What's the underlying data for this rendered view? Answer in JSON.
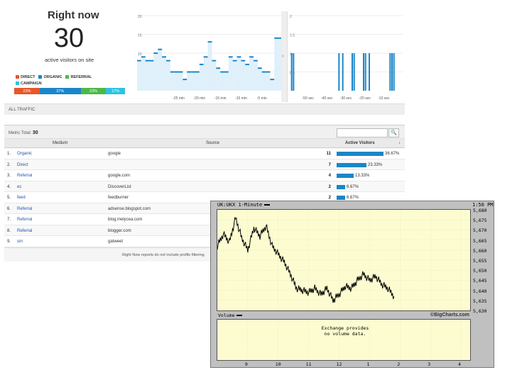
{
  "right_now": {
    "title": "Right now",
    "count": "30",
    "subtitle": "active visitors on site",
    "legend": [
      {
        "label": "DIRECT",
        "color": "#e8562a"
      },
      {
        "label": "ORGANIC",
        "color": "#1a86c8"
      },
      {
        "label": "REFERRAL",
        "color": "#4db848"
      },
      {
        "label": "CAMPAIGN",
        "color": "#2cc2e6"
      }
    ],
    "share": [
      {
        "label": "23%",
        "value": 23,
        "color": "#e8562a"
      },
      {
        "label": "37%",
        "value": 37,
        "color": "#1a86c8"
      },
      {
        "label": "23%",
        "value": 23,
        "color": "#4db848"
      },
      {
        "label": "17%",
        "value": 17,
        "color": "#2cc2e6"
      }
    ]
  },
  "chart_data": [
    {
      "type": "bar",
      "name": "per-minute",
      "ylim": [
        0,
        20
      ],
      "yticks": [
        "20",
        "15",
        "10",
        "5"
      ],
      "xticks": [
        "-25 min",
        "-20 min",
        "-15 min",
        "-10 min",
        "-5 min"
      ],
      "xtick_pos": [
        25,
        20,
        15,
        10,
        5
      ],
      "values": [
        8,
        9,
        8,
        8,
        10,
        11,
        9,
        8,
        5,
        5,
        5,
        3,
        5,
        5,
        5,
        7,
        9,
        13,
        8,
        6,
        5,
        5,
        9,
        8,
        9,
        8,
        7,
        9,
        8,
        6,
        5,
        5,
        3,
        14,
        14
      ],
      "color": "#1a86c8"
    },
    {
      "type": "bar",
      "name": "per-second",
      "ylim": [
        0,
        2
      ],
      "yticks": [
        "2",
        "1.5",
        "1",
        "0.5"
      ],
      "xticks": [
        "-50 sec",
        "-40 sec",
        "-30 sec",
        "-20 sec",
        "-10 sec"
      ],
      "xtick_pos": [
        50,
        40,
        30,
        20,
        10
      ],
      "bars_at": [
        59,
        58,
        34,
        32,
        27,
        26,
        21,
        20,
        18,
        7,
        6,
        5
      ],
      "value": 1,
      "color": "#1a86c8"
    }
  ],
  "all_traffic": "ALL TRAFFIC",
  "table": {
    "metric_label": "Metric Total:",
    "metric_value": "30",
    "search_button": "🔍",
    "headers": {
      "medium": "Medium",
      "source": "Source",
      "active": "Active Visitors",
      "sort": "↓"
    },
    "rows": [
      {
        "num": "1.",
        "medium": "Organic",
        "source": "google",
        "value": "11",
        "pct": "36.67%",
        "fraction": 0.3667
      },
      {
        "num": "2.",
        "medium": "Direct",
        "source": "",
        "value": "7",
        "pct": "23.33%",
        "fraction": 0.2333
      },
      {
        "num": "3.",
        "medium": "Referral",
        "source": "google.com",
        "value": "4",
        "pct": "13.33%",
        "fraction": 0.1333
      },
      {
        "num": "4.",
        "medium": "ec",
        "source": "DiscoverList",
        "value": "2",
        "pct": "6.67%",
        "fraction": 0.0667
      },
      {
        "num": "5.",
        "medium": "feed",
        "source": "feedburner",
        "value": "2",
        "pct": "6.67%",
        "fraction": 0.0667
      },
      {
        "num": "6.",
        "medium": "Referral",
        "source": "adsense.blogspot.com",
        "value": "",
        "pct": "",
        "fraction": 0
      },
      {
        "num": "7.",
        "medium": "Referral",
        "source": "blog.melycea.com",
        "value": "",
        "pct": "",
        "fraction": 0
      },
      {
        "num": "8.",
        "medium": "Referral",
        "source": "blogger.com",
        "value": "",
        "pct": "",
        "fraction": 0
      },
      {
        "num": "9.",
        "medium": "sm",
        "source": "gatweet",
        "value": "",
        "pct": "",
        "fraction": 0
      }
    ],
    "footnote": "Right Now reports do not include profile filtering."
  },
  "bigcharts": {
    "ticker": "UK:UKX 1-Minute",
    "time": "1:50 PM",
    "volume_label": "Volume",
    "copyright": "©BigCharts.com",
    "no_volume_line1": "Exchange provides",
    "no_volume_line2": "no volume data.",
    "y_ticks": [
      "5,680",
      "5,675",
      "5,670",
      "5,665",
      "5,660",
      "5,655",
      "5,650",
      "5,645",
      "5,640",
      "5,635",
      "5,630"
    ],
    "x_ticks": [
      "9",
      "10",
      "11",
      "12",
      "1",
      "2",
      "3",
      "4"
    ]
  },
  "price_series": {
    "type": "line",
    "x_hours": [
      8,
      8.2,
      8.4,
      8.6,
      8.8,
      9,
      9.2,
      9.4,
      9.6,
      9.8,
      10,
      10.2,
      10.4,
      10.6,
      10.8,
      11,
      11.2,
      11.4,
      11.6,
      11.8,
      12,
      12.2,
      12.4,
      12.6,
      12.8,
      13,
      13.2,
      13.4,
      13.6,
      13.8
    ],
    "values": [
      5662,
      5668,
      5664,
      5676,
      5666,
      5660,
      5671,
      5667,
      5672,
      5662,
      5658,
      5654,
      5648,
      5641,
      5640,
      5639,
      5641,
      5638,
      5641,
      5635,
      5638,
      5642,
      5641,
      5645,
      5648,
      5645,
      5647,
      5643,
      5641,
      5637
    ],
    "ylim": [
      5630,
      5680
    ],
    "xlim": [
      8,
      16.3
    ]
  }
}
